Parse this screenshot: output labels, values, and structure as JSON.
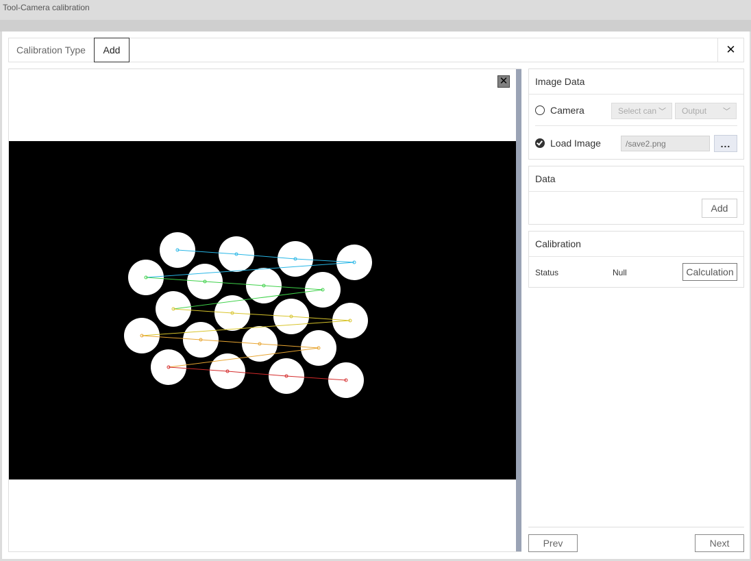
{
  "window": {
    "title": "Tool-Camera calibration"
  },
  "tabs": [
    {
      "label": "Calibration Type"
    },
    {
      "label": "Add"
    }
  ],
  "close_icon": "close-icon",
  "image_data": {
    "heading": "Image Data",
    "camera": {
      "label": "Camera",
      "selected": false,
      "camera_select": "Select can",
      "output_select": "Output"
    },
    "load_image": {
      "label": "Load Image",
      "selected": true,
      "path": "/save2.png",
      "browse_label": "..."
    }
  },
  "data_panel": {
    "heading": "Data",
    "add_label": "Add"
  },
  "calibration": {
    "heading": "Calibration",
    "status_label": "Status",
    "status_value": "Null",
    "calculate_label": "Calculation"
  },
  "footer": {
    "prev_label": "Prev",
    "next_label": "Next"
  },
  "preview": {
    "description_icons": [
      "close-icon"
    ],
    "circle_grid": {
      "rows": 5,
      "cols": 4
    },
    "row_colors": [
      "#27b6e6",
      "#3fd14a",
      "#d8c42b",
      "#e8a531",
      "#d42a2a"
    ]
  }
}
